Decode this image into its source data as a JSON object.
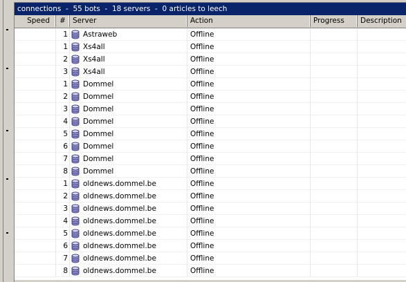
{
  "title": "connections  -  55 bots  -  18 servers  -  0 articles to leech",
  "columns": {
    "speed": "Speed",
    "num": "#",
    "server": "Server",
    "action": "Action",
    "progress": "Progress",
    "description": "Description"
  },
  "icons": {
    "server": "database-icon"
  },
  "rows": [
    {
      "num": "1",
      "server": "Astraweb",
      "action": "Offline"
    },
    {
      "num": "1",
      "server": "Xs4all",
      "action": "Offline"
    },
    {
      "num": "2",
      "server": "Xs4all",
      "action": "Offline"
    },
    {
      "num": "3",
      "server": "Xs4all",
      "action": "Offline"
    },
    {
      "num": "1",
      "server": "Dommel",
      "action": "Offline"
    },
    {
      "num": "2",
      "server": "Dommel",
      "action": "Offline"
    },
    {
      "num": "3",
      "server": "Dommel",
      "action": "Offline"
    },
    {
      "num": "4",
      "server": "Dommel",
      "action": "Offline"
    },
    {
      "num": "5",
      "server": "Dommel",
      "action": "Offline"
    },
    {
      "num": "6",
      "server": "Dommel",
      "action": "Offline"
    },
    {
      "num": "7",
      "server": "Dommel",
      "action": "Offline"
    },
    {
      "num": "8",
      "server": "Dommel",
      "action": "Offline"
    },
    {
      "num": "1",
      "server": "oldnews.dommel.be",
      "action": "Offline"
    },
    {
      "num": "2",
      "server": "oldnews.dommel.be",
      "action": "Offline"
    },
    {
      "num": "3",
      "server": "oldnews.dommel.be",
      "action": "Offline"
    },
    {
      "num": "4",
      "server": "oldnews.dommel.be",
      "action": "Offline"
    },
    {
      "num": "5",
      "server": "oldnews.dommel.be",
      "action": "Offline"
    },
    {
      "num": "6",
      "server": "oldnews.dommel.be",
      "action": "Offline"
    },
    {
      "num": "7",
      "server": "oldnews.dommel.be",
      "action": "Offline"
    },
    {
      "num": "8",
      "server": "oldnews.dommel.be",
      "action": "Offline"
    }
  ]
}
